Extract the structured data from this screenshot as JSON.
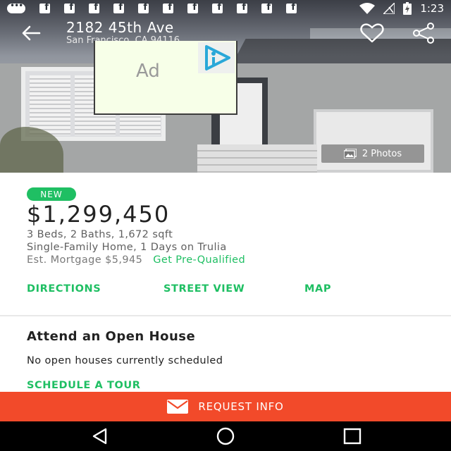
{
  "status_bar": {
    "time": "1:23",
    "notification_icons": [
      "message-icon",
      "facebook-icon",
      "facebook-icon",
      "facebook-icon",
      "facebook-icon",
      "facebook-icon",
      "facebook-icon",
      "facebook-icon",
      "facebook-icon",
      "facebook-icon",
      "facebook-icon",
      "facebook-icon"
    ],
    "right_icons": [
      "wifi-icon",
      "signal-off-icon",
      "battery-charging-icon"
    ]
  },
  "header": {
    "address": "2182 45th Ave",
    "city_state_zip": "San Francisco, CA 94116"
  },
  "photos": {
    "label": "2 Photos"
  },
  "ad": {
    "label": "Ad"
  },
  "listing": {
    "badge": "NEW",
    "price": "$1,299,450",
    "facts": "3 Beds, 2 Baths, 1,672 sqft",
    "property_type": "Single-Family Home, 1 Days on Trulia",
    "mortgage": "Est. Mortgage $5,945",
    "prequal_link": "Get Pre-Qualified"
  },
  "actions": {
    "directions": "DIRECTIONS",
    "street_view": "STREET VIEW",
    "map": "MAP"
  },
  "open_house": {
    "title": "Attend an Open House",
    "text": "No open houses currently scheduled",
    "schedule_link": "SCHEDULE A TOUR"
  },
  "request_info": {
    "label": "REQUEST INFO"
  },
  "colors": {
    "accent_green": "#1fbf63",
    "request_orange": "#f24a2a"
  }
}
